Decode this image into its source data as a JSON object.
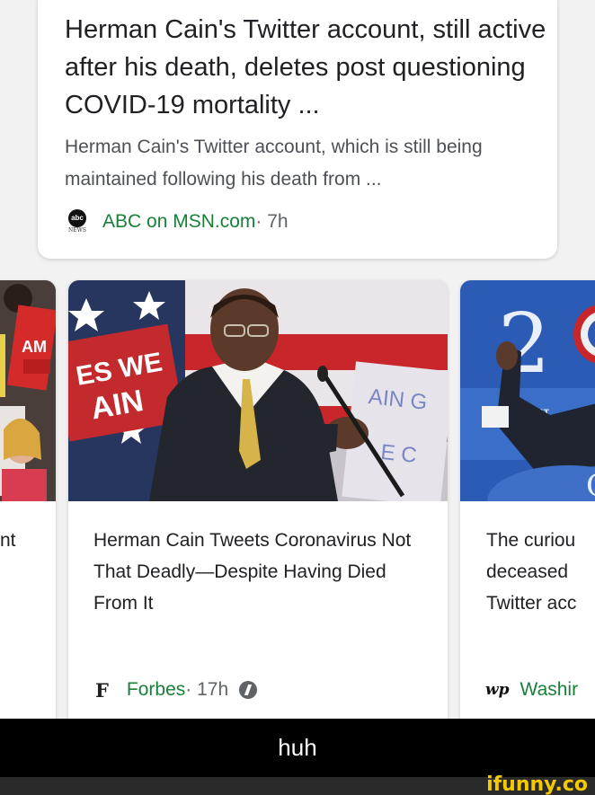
{
  "top_article": {
    "title": "Herman Cain's Twitter account, still active after his death, deletes post questioning COVID-19 mortality ...",
    "snippet": "Herman Cain's Twitter account, which is still being maintained following his death from ...",
    "source": "ABC on MSN.com",
    "time": " · 7h",
    "logo_text": "abc",
    "logo_subtext": "NEWS"
  },
  "carousel": {
    "left_card": {
      "title_fragment": "nt"
    },
    "middle_card": {
      "title": "Herman Cain Tweets Coronavirus Not That Deadly—Despite Having Died From It",
      "source_logo": "F",
      "source": "Forbes",
      "time": " · 17h",
      "badge_icon": "amp-icon"
    },
    "right_card": {
      "title_line1": "The curiou",
      "title_line2": "deceased",
      "title_line3": "Twitter acc",
      "source_logo": "wp",
      "source": "Washir"
    }
  },
  "caption": "huh",
  "watermark": "ifunny.co",
  "colors": {
    "source_green": "#188038",
    "title": "#202124",
    "snippet": "#4d5156",
    "watermark": "#f6c800"
  }
}
